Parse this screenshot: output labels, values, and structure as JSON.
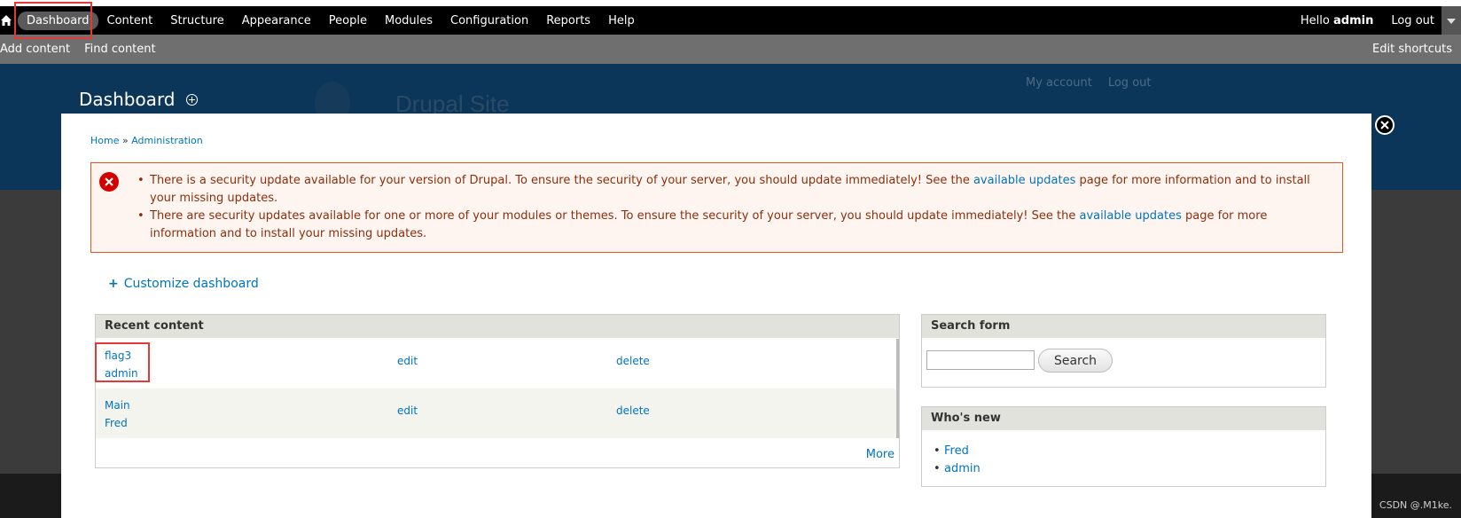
{
  "toolbar": {
    "menu": [
      "Dashboard",
      "Content",
      "Structure",
      "Appearance",
      "People",
      "Modules",
      "Configuration",
      "Reports",
      "Help"
    ],
    "hello_prefix": "Hello",
    "username": "admin",
    "logout": "Log out"
  },
  "shortcuts": {
    "add_content": "Add content",
    "find_content": "Find content",
    "edit_shortcuts": "Edit shortcuts"
  },
  "header": {
    "site_name": "Drupal Site",
    "my_account": "My account",
    "log_out": "Log out",
    "page_title": "Dashboard"
  },
  "breadcrumb": {
    "home": "Home",
    "sep": "»",
    "admin": "Administration"
  },
  "messages": {
    "m1_text_a": "There is a security update available for your version of Drupal. To ensure the security of your server, you should update immediately! See the",
    "m1_link": "available updates",
    "m1_text_b": "page for more information and to install your missing updates.",
    "m2_text_a": "There are security updates available for one or more of your modules or themes. To ensure the security of your server, you should update immediately! See the",
    "m2_link": "available updates",
    "m2_text_b": "page for more information and to install your missing updates."
  },
  "customize": {
    "plus": "+",
    "label": "Customize dashboard"
  },
  "recent_content": {
    "title": "Recent content",
    "rows": [
      {
        "title": "flag3",
        "author": "admin",
        "edit": "edit",
        "delete": "delete"
      },
      {
        "title": "Main",
        "author": "Fred",
        "edit": "edit",
        "delete": "delete"
      }
    ],
    "more": "More"
  },
  "search_form": {
    "title": "Search form",
    "button": "Search"
  },
  "whos_new": {
    "title": "Who's new",
    "users": [
      "Fred",
      "admin"
    ]
  },
  "watermark": "CSDN @.M1ke."
}
